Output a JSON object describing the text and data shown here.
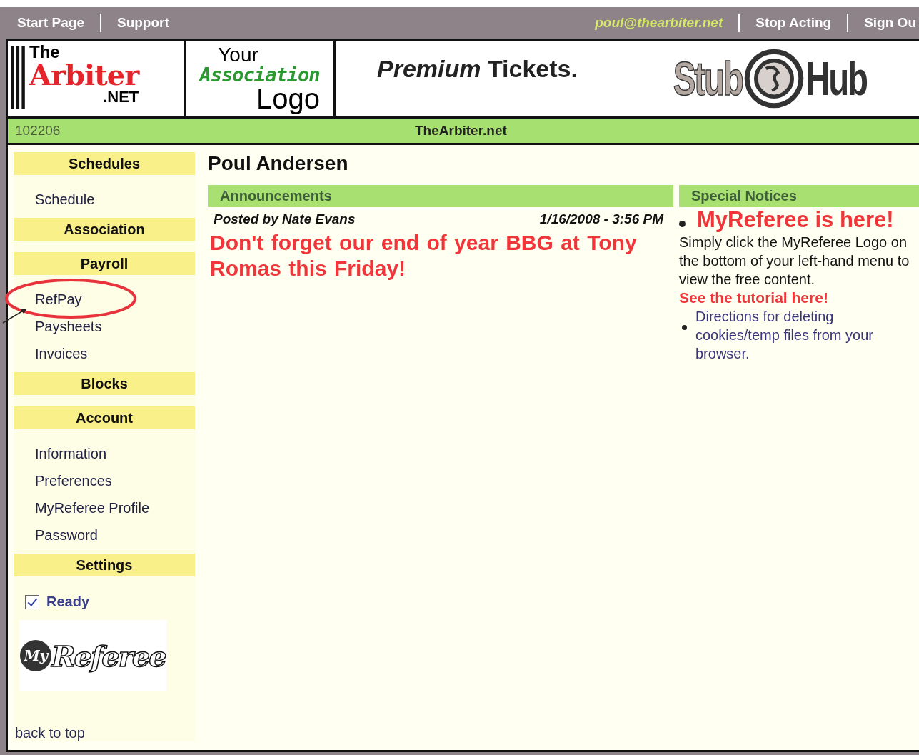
{
  "top_bar": {
    "left_links": [
      "Start Page",
      "Support"
    ],
    "user_email": "poul@thearbiter.net",
    "right_links": [
      "Stop Acting",
      "Sign Ou"
    ]
  },
  "banner": {
    "arbiter_logo": {
      "line_1": "The",
      "line_2": "Arbiter",
      "line_3": ".NET"
    },
    "association_logo": {
      "line_1": "Your",
      "line_2": "Association",
      "line_3": "Logo"
    },
    "ad": {
      "emphasis": "Premium",
      "text": "Tickets.",
      "brand_left": "Stub",
      "brand_right": "Hub"
    }
  },
  "status_bar": {
    "id": "102206",
    "site": "TheArbiter.net"
  },
  "sidebar": {
    "sections": [
      {
        "heading": "Schedules",
        "items": [
          "Schedule"
        ]
      },
      {
        "heading": "Association"
      },
      {
        "heading": "Payroll",
        "items": [
          "RefPay",
          "Paysheets",
          "Invoices"
        ]
      },
      {
        "heading": "Blocks"
      },
      {
        "heading": "Account",
        "items": [
          "Information",
          "Preferences",
          "MyReferee Profile",
          "Password"
        ]
      },
      {
        "heading": "Settings"
      }
    ],
    "ready_checkbox": {
      "label": "Ready",
      "checked": true
    },
    "myreferee_logo": {
      "my": "My",
      "word": "Referee"
    },
    "back_to_top": "back to top"
  },
  "user_name": "Poul Andersen",
  "announcements": {
    "title": "Announcements",
    "posts": [
      {
        "author": "Posted by Nate Evans",
        "time": "1/16/2008 - 3:56 PM",
        "message": "Don't forget our end of year BBG at Tony Romas this Friday!"
      }
    ]
  },
  "special_notices": {
    "title": "Special Notices",
    "items": [
      {
        "kind": "headline",
        "text": "MyReferee is here!"
      },
      {
        "kind": "text",
        "text": "Simply click the MyReferee Logo on the bottom of your left-hand menu to view the free content."
      },
      {
        "kind": "link",
        "text": "See the tutorial here!"
      },
      {
        "kind": "bullet-link",
        "text": "Directions for deleting cookies/temp files from your browser."
      }
    ]
  }
}
